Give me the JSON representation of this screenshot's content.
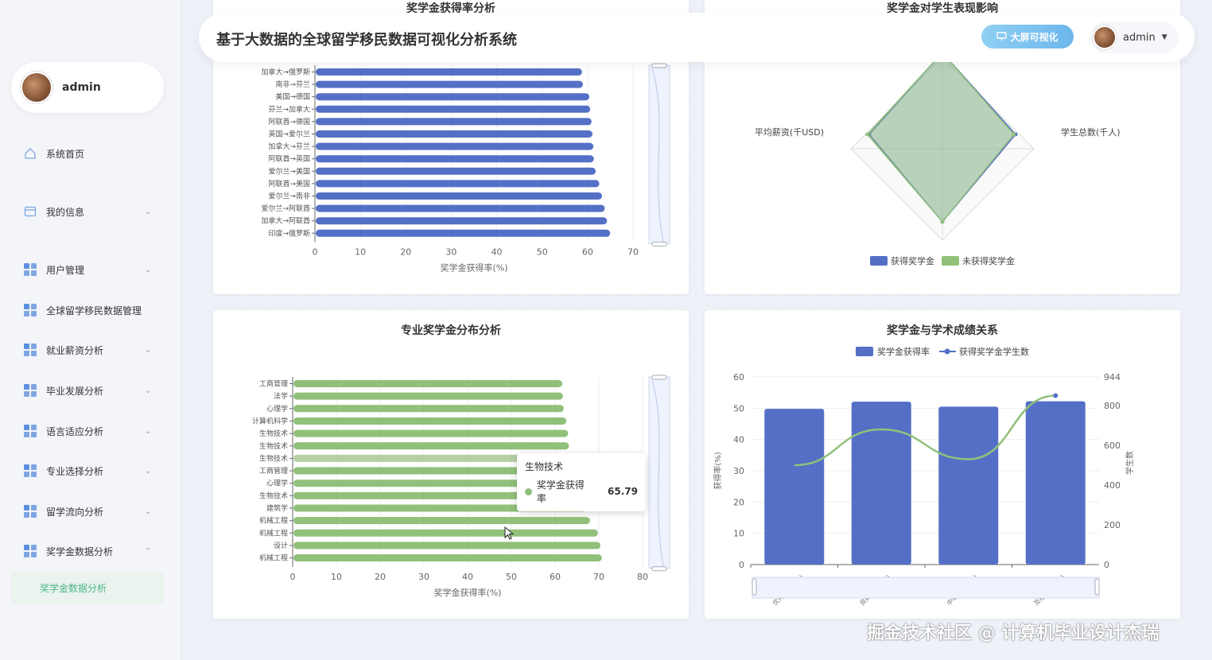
{
  "header": {
    "title": "基于大数据的全球留学移民数据可视化分析系统",
    "bigscreen_label": "大屏可视化",
    "user": "admin"
  },
  "sidebar": {
    "user": "admin",
    "items": [
      {
        "label": "系统首页",
        "icon": "home-icon"
      },
      {
        "label": "我的信息",
        "icon": "card-icon"
      },
      {
        "label": "用户管理",
        "icon": "grid-icon"
      },
      {
        "label": "全球留学移民数据管理",
        "icon": "grid-icon"
      },
      {
        "label": "就业薪资分析",
        "icon": "grid-icon"
      },
      {
        "label": "毕业发展分析",
        "icon": "grid-icon"
      },
      {
        "label": "语言适应分析",
        "icon": "grid-icon"
      },
      {
        "label": "专业选择分析",
        "icon": "grid-icon"
      },
      {
        "label": "留学流向分析",
        "icon": "grid-icon"
      },
      {
        "label": "奖学金数据分析",
        "icon": "grid-icon"
      }
    ],
    "active_sub": "奖学金数据分析"
  },
  "colors": {
    "blue": "#5470c6",
    "green": "#91c07a",
    "accent": "#4bb58a"
  },
  "watermark": "掘金技术社区 @ 计算机毕业设计杰瑞",
  "tooltip": {
    "category": "生物技术",
    "series": "奖学金获得率",
    "value": "65.79"
  },
  "chart_data": [
    {
      "type": "bar",
      "orientation": "horizontal",
      "title": "奖学金获得率分析",
      "xlabel": "奖学金获得率(%)",
      "xlim": [
        0,
        70
      ],
      "xticks": [
        0,
        10,
        20,
        30,
        40,
        50,
        60,
        70
      ],
      "categories": [
        "加拿大→俄罗斯",
        "南非→芬兰",
        "美国→德国",
        "芬兰→加拿大",
        "阿联酋→德国",
        "英国→爱尔兰",
        "加拿大→芬兰",
        "阿联酋→英国",
        "爱尔兰→美国",
        "阿联酋→美国",
        "爱尔兰→南非",
        "爱尔兰→阿联酋",
        "加拿大→阿联酋",
        "印度→俄罗斯"
      ],
      "values": [
        58.6,
        58.8,
        60.2,
        60.4,
        60.7,
        60.9,
        61.1,
        61.2,
        61.6,
        62.4,
        63.0,
        63.6,
        64.1,
        64.8
      ],
      "color": "#5470c6"
    },
    {
      "type": "radar",
      "title": "奖学金对学生表现影响",
      "indicators": [
        "学生总数(千人)",
        "平均薪资(千USD)"
      ],
      "series": [
        {
          "name": "获得奖学金",
          "values": [
            0.8,
            0.8
          ]
        },
        {
          "name": "未获得奖学金",
          "values": [
            0.78,
            0.82
          ]
        }
      ]
    },
    {
      "type": "bar",
      "orientation": "horizontal",
      "title": "专业奖学金分布分析",
      "xlabel": "奖学金获得率(%)",
      "xlim": [
        0,
        80
      ],
      "xticks": [
        0,
        10,
        20,
        30,
        40,
        50,
        60,
        70,
        80
      ],
      "categories": [
        "工商管理",
        "法学",
        "心理学",
        "计算机科学",
        "生物技术",
        "生物技术",
        "生物技术",
        "工商管理",
        "心理学",
        "生物技术",
        "建筑学",
        "机械工程",
        "机械工程",
        "设计",
        "机械工程"
      ],
      "values": [
        61.5,
        61.6,
        61.8,
        62.4,
        62.8,
        63.0,
        65.79,
        65.9,
        66.3,
        66.7,
        66.9,
        67.8,
        69.6,
        70.2,
        70.5
      ],
      "highlight_index": 6,
      "color": "#91c07a"
    },
    {
      "type": "bar+line",
      "title": "奖学金与学术成绩关系",
      "categories": [
        "优秀(3.7-4.0)",
        "良好(3.3-3.7)",
        "中等(3.0-3.3)",
        "及格(2.5-3.0)"
      ],
      "ylabel": "获得率(%)",
      "y2label": "学生数",
      "ylim": [
        0,
        60
      ],
      "yticks": [
        0,
        10,
        20,
        30,
        40,
        50,
        60
      ],
      "y2ticks": [
        0,
        200,
        400,
        600,
        800,
        944
      ],
      "y2max": 944,
      "series": [
        {
          "name": "奖学金获得率",
          "type": "bar",
          "values": [
            49.8,
            52.1,
            50.5,
            52.2
          ]
        },
        {
          "name": "获得奖学金学生数",
          "type": "line",
          "values": [
            500,
            680,
            530,
            850
          ]
        }
      ]
    }
  ]
}
